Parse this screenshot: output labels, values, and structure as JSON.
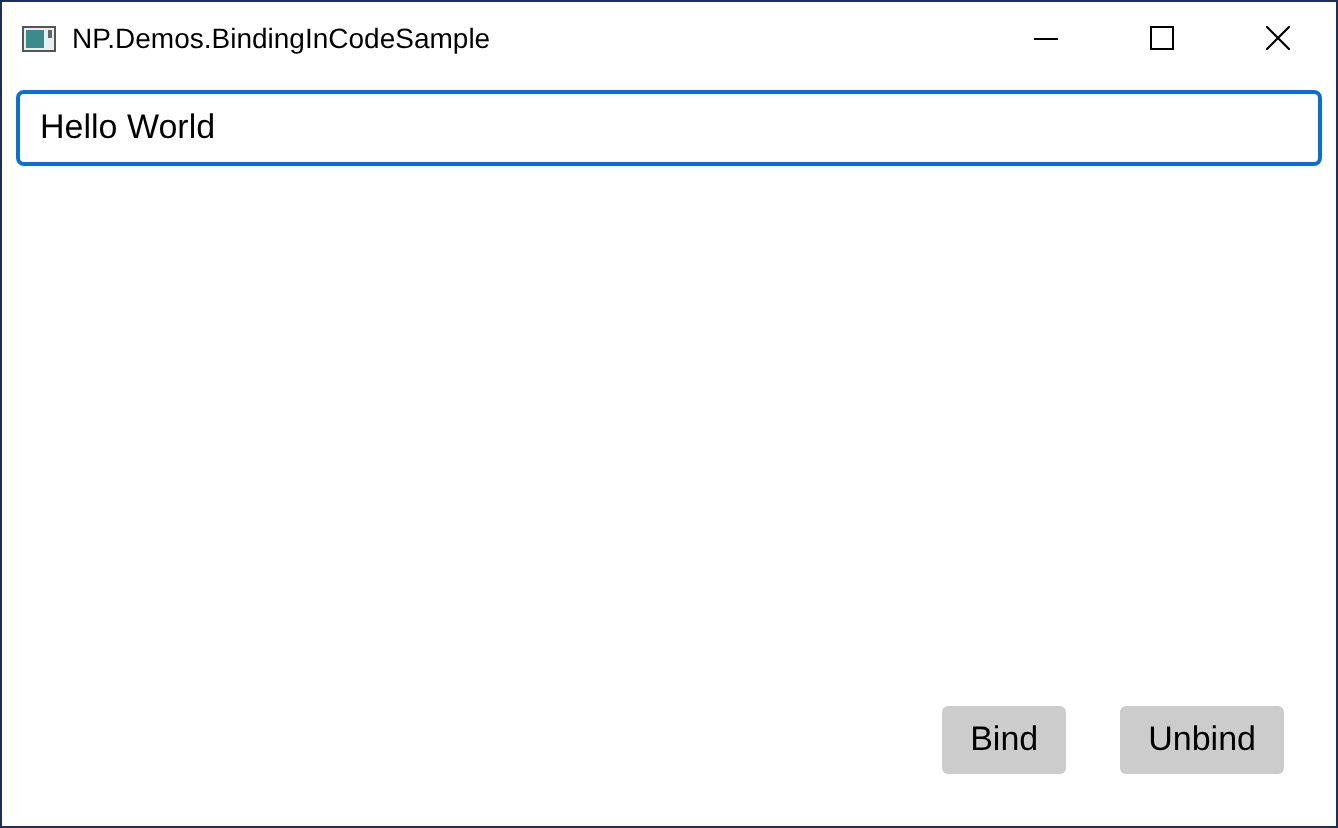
{
  "window": {
    "title": "NP.Demos.BindingInCodeSample"
  },
  "text_box": {
    "value": "Hello World",
    "focused": true
  },
  "buttons": [
    "Bind",
    "Unbind"
  ]
}
